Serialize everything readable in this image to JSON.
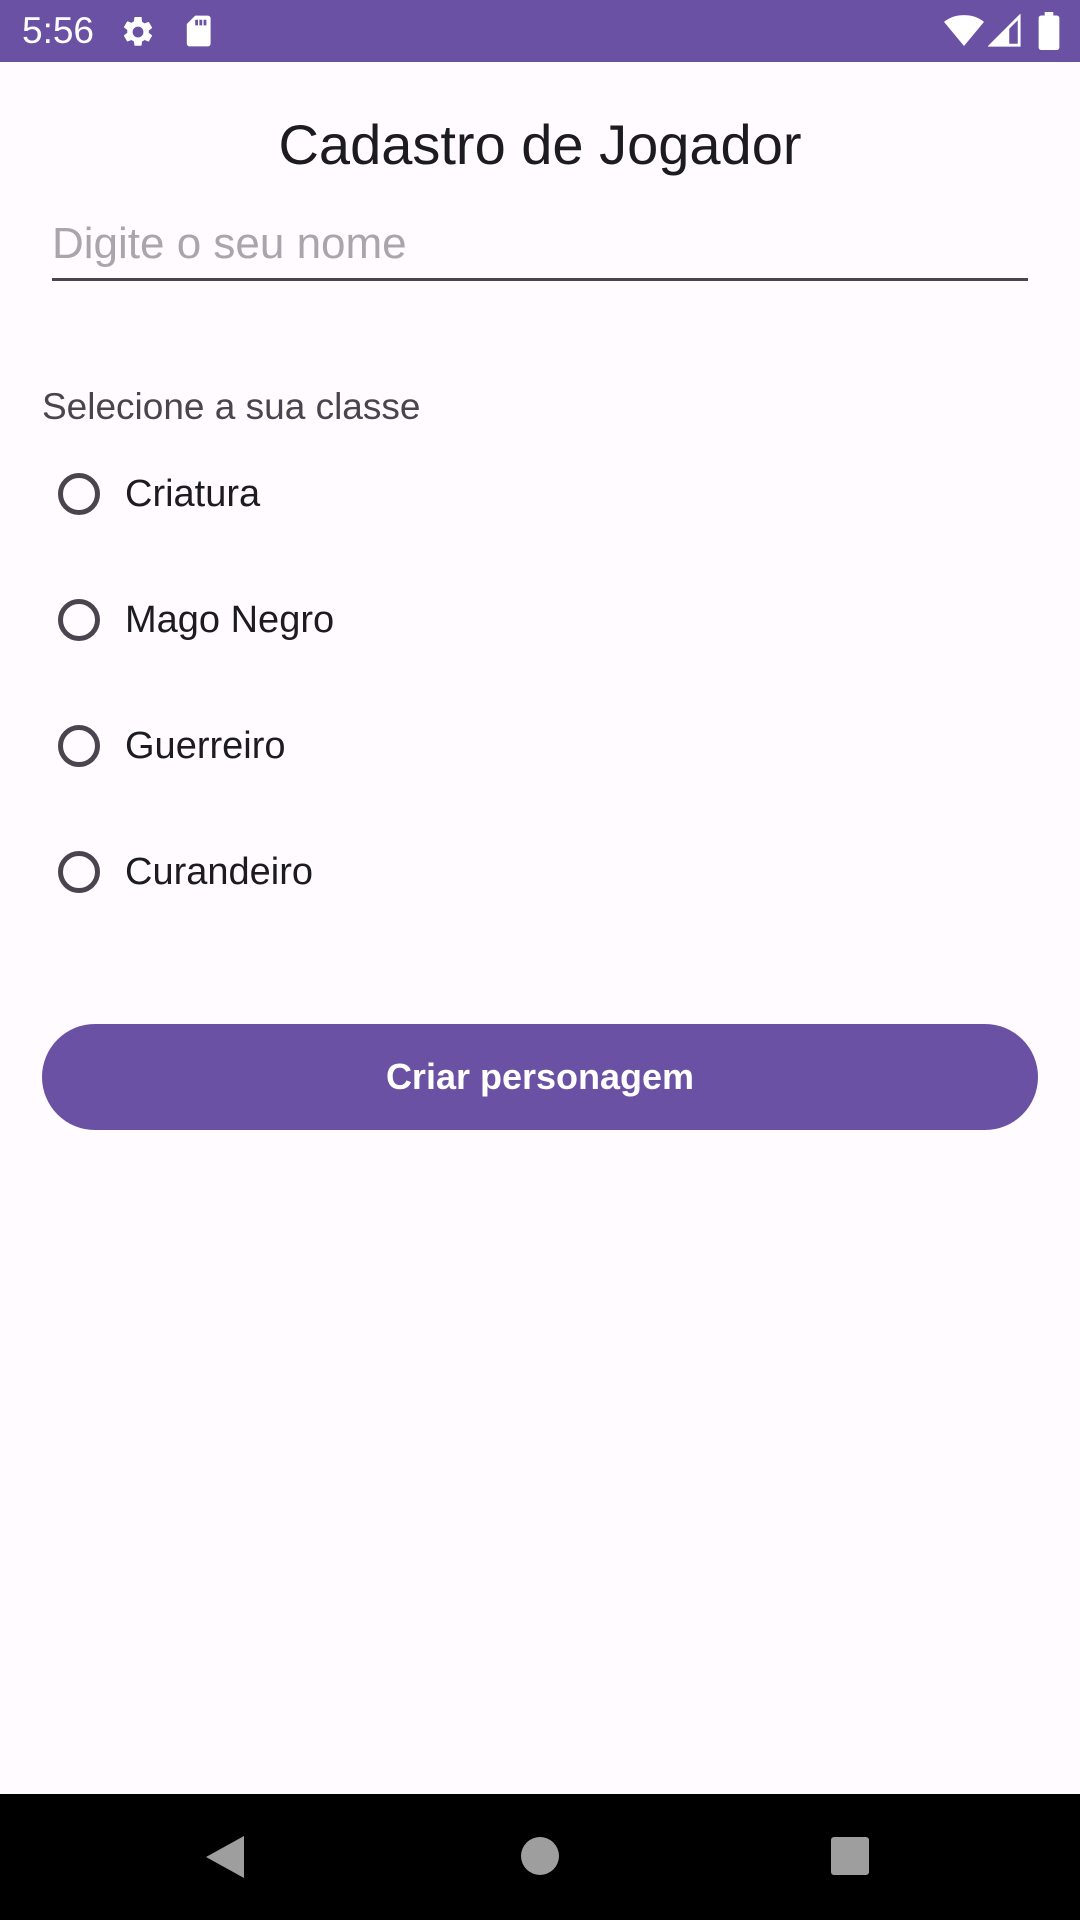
{
  "status_bar": {
    "time": "5:56",
    "icons": [
      "gear-icon",
      "sd-card-icon",
      "wifi-icon",
      "signal-icon",
      "battery-icon"
    ],
    "background_color": "#6A51A3"
  },
  "form": {
    "title": "Cadastro de Jogador",
    "name_placeholder": "Digite o seu nome",
    "name_value": "",
    "class_label": "Selecione a sua classe",
    "class_options": [
      {
        "label": "Criatura",
        "selected": false
      },
      {
        "label": "Mago Negro",
        "selected": false
      },
      {
        "label": "Guerreiro",
        "selected": false
      },
      {
        "label": "Curandeiro",
        "selected": false
      }
    ],
    "submit_label": "Criar personagem",
    "accent_color": "#6A51A3"
  },
  "nav_bar": {
    "icons": [
      "back-icon",
      "home-icon",
      "recents-icon"
    ]
  }
}
